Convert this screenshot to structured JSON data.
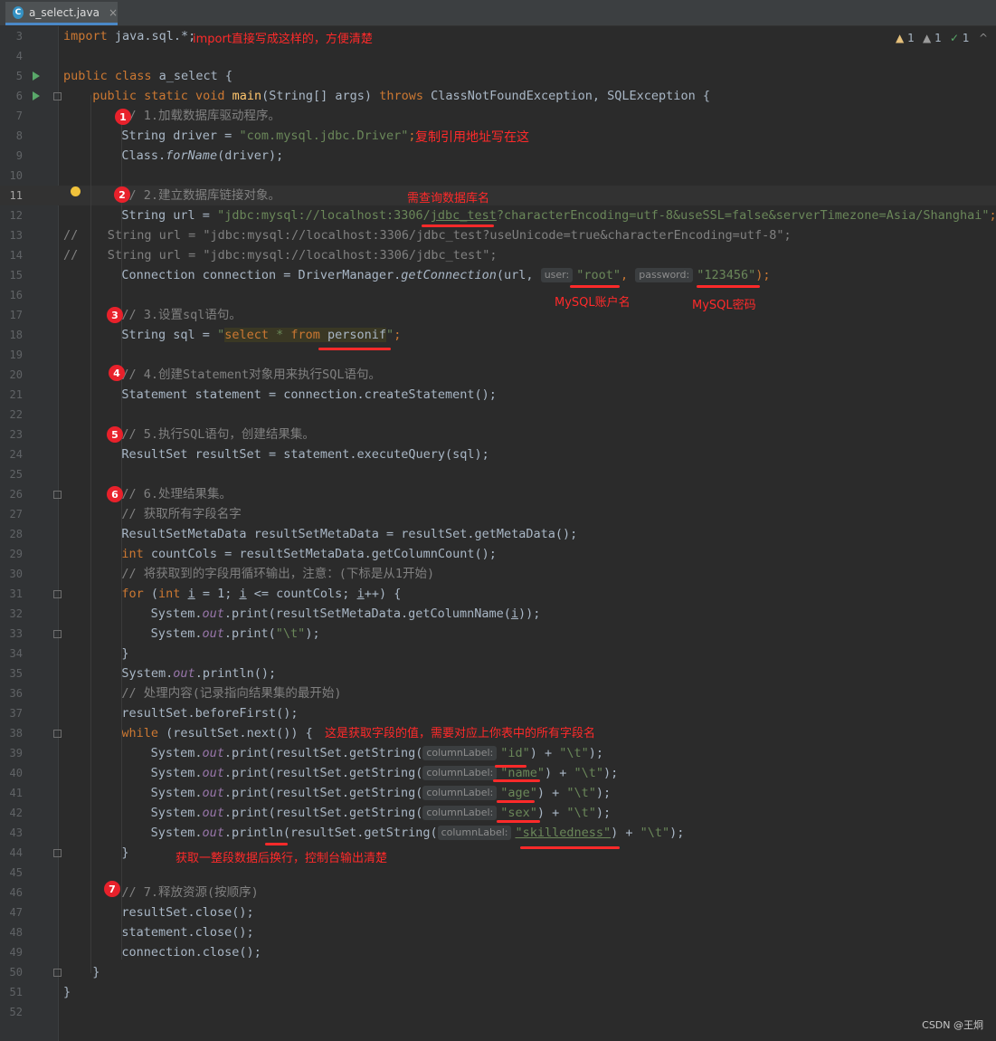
{
  "tab": {
    "icon": "C",
    "filename": "a_select.java",
    "close": "×"
  },
  "status": {
    "warn1": "1",
    "warn2": "1",
    "ok": "1"
  },
  "line_numbers": [
    "3",
    "4",
    "5",
    "6",
    "7",
    "8",
    "9",
    "10",
    "11",
    "12",
    "13",
    "14",
    "15",
    "16",
    "17",
    "18",
    "19",
    "20",
    "21",
    "22",
    "23",
    "24",
    "25",
    "26",
    "27",
    "28",
    "29",
    "30",
    "31",
    "32",
    "33",
    "34",
    "35",
    "36",
    "37",
    "38",
    "39",
    "40",
    "41",
    "42",
    "43",
    "44",
    "45",
    "46",
    "47",
    "48",
    "49",
    "50",
    "51",
    "52"
  ],
  "code": {
    "l3": {
      "k": "import",
      "t": " java.sql.*;"
    },
    "l5": {
      "k": "public class",
      "t": " a_select {"
    },
    "l6": {
      "k1": "public static void",
      "fn": " main",
      "t1": "(String[] args) ",
      "k2": "throws",
      "t2": " ClassNotFoundException, SQLException {"
    },
    "l7": "// 1.加载数据库驱动程序。",
    "l8": {
      "t": "String driver = ",
      "s": "\"com.mysql.jdbc.Driver\"",
      "e": ";"
    },
    "l9": {
      "t": "Class.",
      "m": "forName",
      "e": "(driver);"
    },
    "l11": "// 2.建立数据库链接对象。",
    "l12": {
      "t": "String url = ",
      "s1": "\"jdbc:mysql://localhost:3306/",
      "s2": "jdbc_test",
      "s3": "?characterEncoding=utf-8&useSSL=false&serverTimezone=Asia/Shanghai\"",
      "e": ";"
    },
    "l13": "//    String url = \"jdbc:mysql://localhost:3306/jdbc_test?useUnicode=true&characterEncoding=utf-8\";",
    "l14": "//    String url = \"jdbc:mysql://localhost:3306/jdbc_test\";",
    "l15": {
      "t1": "Connection connection = DriverManager.",
      "m": "getConnection",
      "t2": "(url, ",
      "h1": "user:",
      "s1": "\"root\"",
      "t3": ", ",
      "h2": "password:",
      "s2": "\"123456\"",
      "e": ");"
    },
    "l17": "// 3.设置sql语句。",
    "l18": {
      "t": "String sql = ",
      "q1": "\"",
      "sk1": "select",
      "sp1": " * ",
      "sk2": "from",
      "sp2": " personif",
      "q2": "\"",
      "e": ";"
    },
    "l20": "// 4.创建Statement对象用来执行SQL语句。",
    "l21": {
      "t": "Statement statement = connection.createStatement();"
    },
    "l23": "// 5.执行SQL语句，创建结果集。",
    "l24": {
      "t": "ResultSet resultSet = statement.executeQuery(sql);"
    },
    "l26": "// 6.处理结果集。",
    "l27": "// 获取所有字段名字",
    "l28": {
      "t": "ResultSetMetaData resultSetMetaData = resultSet.getMetaData();"
    },
    "l29": {
      "k": "int",
      "t": " countCols = resultSetMetaData.getColumnCount();"
    },
    "l30": "// 将获取到的字段用循环输出，注意：(下标是从1开始)",
    "l31": {
      "k1": "for",
      "t1": " (",
      "k2": "int",
      "t2": " ",
      "v1": "i",
      "t3": " = 1; ",
      "v2": "i",
      "t4": " <= countCols; ",
      "v3": "i",
      "t5": "++) {"
    },
    "l32": {
      "t1": "System.",
      "f": "out",
      "t2": ".print(resultSetMetaData.getColumnName(",
      "v": "i",
      "t3": "));"
    },
    "l33": {
      "t1": "System.",
      "f": "out",
      "t2": ".print(",
      "s": "\"\\t\"",
      "t3": ");"
    },
    "l34": "}",
    "l35": {
      "t1": "System.",
      "f": "out",
      "t2": ".println();"
    },
    "l36": "// 处理内容(记录指向结果集的最开始)",
    "l37": {
      "t": "resultSet.beforeFirst();"
    },
    "l38": {
      "k": "while",
      "t": " (resultSet.next()) {"
    },
    "l39": {
      "t1": "System.",
      "f": "out",
      "t2": ".print(resultSet.getString(",
      "h": "columnLabel:",
      "s": "\"id\"",
      "t3": ") + ",
      "s2": "\"\\t\"",
      "t4": ");"
    },
    "l40": {
      "t1": "System.",
      "f": "out",
      "t2": ".print(resultSet.getString(",
      "h": "columnLabel:",
      "s": "\"name\"",
      "t3": ") + ",
      "s2": "\"\\t\"",
      "t4": ");"
    },
    "l41": {
      "t1": "System.",
      "f": "out",
      "t2": ".print(resultSet.getString(",
      "h": "columnLabel:",
      "s": "\"age\"",
      "t3": ") + ",
      "s2": "\"\\t\"",
      "t4": ");"
    },
    "l42": {
      "t1": "System.",
      "f": "out",
      "t2": ".print(resultSet.getString(",
      "h": "columnLabel:",
      "s": "\"sex\"",
      "t3": ") + ",
      "s2": "\"\\t\"",
      "t4": ");"
    },
    "l43": {
      "t1": "System.",
      "f": "out",
      "t2": ".println(resultSet.getString(",
      "h": "columnLabel:",
      "s": "\"skilledness\"",
      "t3": ") + ",
      "s2": "\"\\t\"",
      "t4": ");"
    },
    "l44": "}",
    "l46": "// 7.释放资源(按顺序)",
    "l47": {
      "t": "resultSet.close();"
    },
    "l48": {
      "t": "statement.close();"
    },
    "l49": {
      "t": "connection.close();"
    },
    "l50": "}",
    "l51": "}"
  },
  "annotations": {
    "import_note": "import直接写成这样的，方便清楚",
    "driver_note": "复制引用地址写在这",
    "db_note": "需查询数据库名",
    "user_note": "MySQL账户名",
    "pwd_note": "MySQL密码",
    "field_note": "这是获取字段的值，需要对应上你表中的所有字段名",
    "println_note": "获取一整段数据后换行，控制台输出清楚",
    "steps": [
      "1",
      "2",
      "3",
      "4",
      "5",
      "6",
      "7"
    ]
  },
  "watermark": "CSDN @王炯"
}
